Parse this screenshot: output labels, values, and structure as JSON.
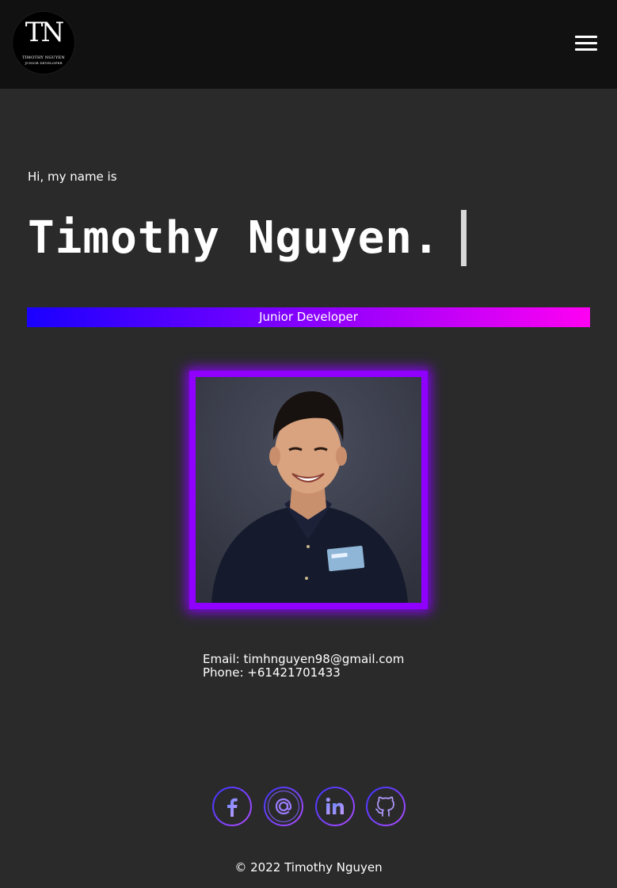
{
  "header": {
    "logo": {
      "monogram": "TN",
      "name": "TIMOTHY NGUYEN",
      "subtitle": "JUNIOR DEVELOPER"
    },
    "menu_icon": "hamburger-menu-icon"
  },
  "hero": {
    "intro": "Hi, my name is",
    "name": "Timothy Nguyen.",
    "role": "Junior Developer"
  },
  "contact": {
    "email_line": "Email: timhnguyen98@gmail.com",
    "phone_line": "Phone: +61421701433"
  },
  "socials": [
    {
      "icon": "facebook-icon"
    },
    {
      "icon": "email-at-icon"
    },
    {
      "icon": "linkedin-icon"
    },
    {
      "icon": "github-icon"
    }
  ],
  "footer": {
    "copyright": "© 2022 Timothy Nguyen"
  },
  "colors": {
    "background": "#2a2a2b",
    "header": "#111112",
    "accent_purple": "#8f00ff",
    "gradient_start": "#1a00ff",
    "gradient_end": "#ff00f2"
  }
}
